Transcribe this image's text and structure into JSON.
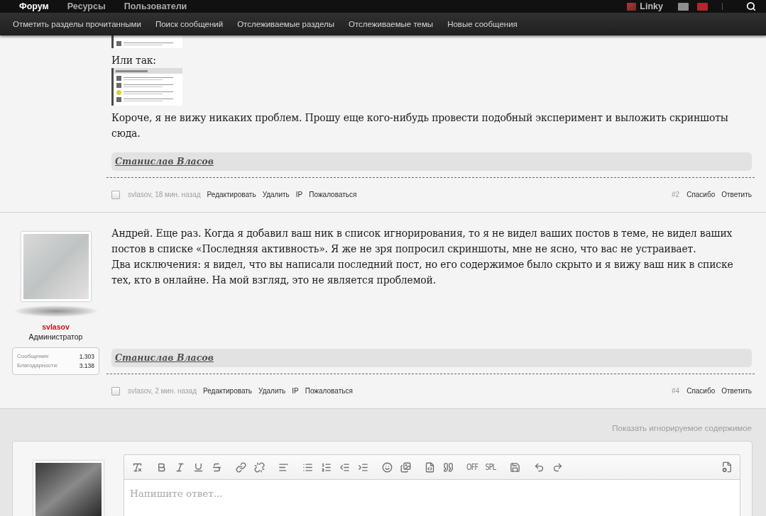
{
  "top_nav": {
    "tabs": [
      {
        "label": "Форум",
        "selected": true
      },
      {
        "label": "Ресурсы",
        "selected": false
      },
      {
        "label": "Пользователи",
        "selected": false
      }
    ],
    "username": "Linky"
  },
  "sub_nav": [
    "Отметить разделы прочитанными",
    "Поиск сообщений",
    "Отслеживаемые разделы",
    "Отслеживаемые темы",
    "Новые сообщения"
  ],
  "posts": [
    {
      "content": [
        {
          "kind": "partial_image"
        },
        {
          "kind": "text",
          "text": "Или так:"
        },
        {
          "kind": "image"
        },
        {
          "kind": "text",
          "text": "Короче, я не вижу никаких проблем. Прошу еще кого-нибудь провести подобный эксперимент и выложить скриншоты сюда."
        }
      ],
      "signature": "Станислав Власов",
      "footer": {
        "checked": false,
        "byline": "svlasov, 18 мин. назад",
        "actions": [
          "Редактировать",
          "Удалить",
          "IP",
          "Пожаловаться"
        ],
        "number": "#2",
        "right_actions": [
          "Спасибо",
          "Ответить"
        ]
      }
    },
    {
      "author": {
        "name": "svlasov",
        "role": "Администратор",
        "stats": [
          {
            "label": "Сообщения:",
            "value": "1.303"
          },
          {
            "label": "Благодарности:",
            "value": "3.138"
          }
        ]
      },
      "content": [
        {
          "kind": "text",
          "text": "Андрей. Еще раз. Когда я добавил ваш ник в список игнорирования, то я не видел ваших постов в теме, не видел ваших постов в списке «Последняя активность». Я же не зря попросил скриншоты, мне не ясно, что вас не устраивает."
        },
        {
          "kind": "text",
          "text": "Два исключения: я видел, что вы написали последний пост, но его содержимое было скрыто и я вижу ваш ник в списке тех, кто в онлайне. На мой взгляд, это не является проблемой."
        }
      ],
      "signature": "Станислав Власов",
      "footer": {
        "checked": false,
        "byline": "svlasov, 2 мин. назад",
        "actions": [
          "Редактировать",
          "Удалить",
          "IP",
          "Пожаловаться"
        ],
        "number": "#4",
        "right_actions": [
          "Спасибо",
          "Ответить"
        ]
      }
    }
  ],
  "show_ignored": "Показать игнорируемое содержимое",
  "reply": {
    "text_buttons": [
      "OFF",
      "SPL"
    ],
    "placeholder": "Напишите ответ..."
  }
}
